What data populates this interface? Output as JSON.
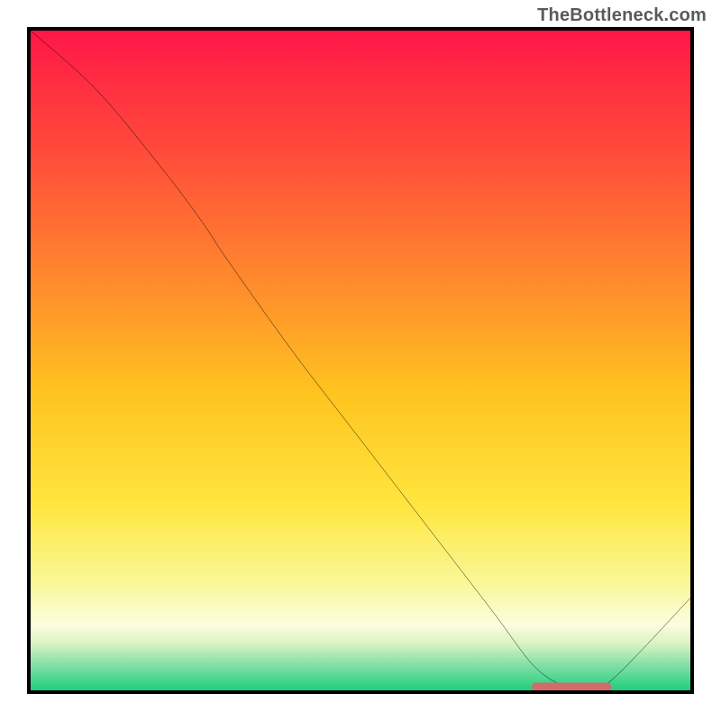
{
  "attribution": "TheBottleneck.com",
  "chart_data": {
    "type": "line",
    "title": "",
    "xlabel": "",
    "ylabel": "",
    "xlim": [
      0,
      100
    ],
    "ylim": [
      0,
      100
    ],
    "series": [
      {
        "name": "curve",
        "x": [
          0,
          10,
          20,
          26,
          30,
          40,
          50,
          60,
          70,
          76,
          80,
          82,
          84,
          88,
          100
        ],
        "y": [
          100,
          91,
          79,
          71,
          65,
          51,
          38,
          25,
          12,
          4,
          1,
          0.5,
          0.5,
          1.5,
          14
        ]
      }
    ],
    "marker": {
      "x_center": 82,
      "x_width": 12,
      "y": 0.5
    },
    "gradient_stops": [
      {
        "offset": 0.0,
        "color": "#ff1747"
      },
      {
        "offset": 0.18,
        "color": "#ff4a3a"
      },
      {
        "offset": 0.38,
        "color": "#ff8a2d"
      },
      {
        "offset": 0.55,
        "color": "#ffc41f"
      },
      {
        "offset": 0.72,
        "color": "#ffe63f"
      },
      {
        "offset": 0.84,
        "color": "#f9f89a"
      },
      {
        "offset": 0.9,
        "color": "#fdfde0"
      },
      {
        "offset": 0.93,
        "color": "#d9f3c2"
      },
      {
        "offset": 0.96,
        "color": "#86e0a8"
      },
      {
        "offset": 1.0,
        "color": "#1fcf7e"
      }
    ]
  }
}
